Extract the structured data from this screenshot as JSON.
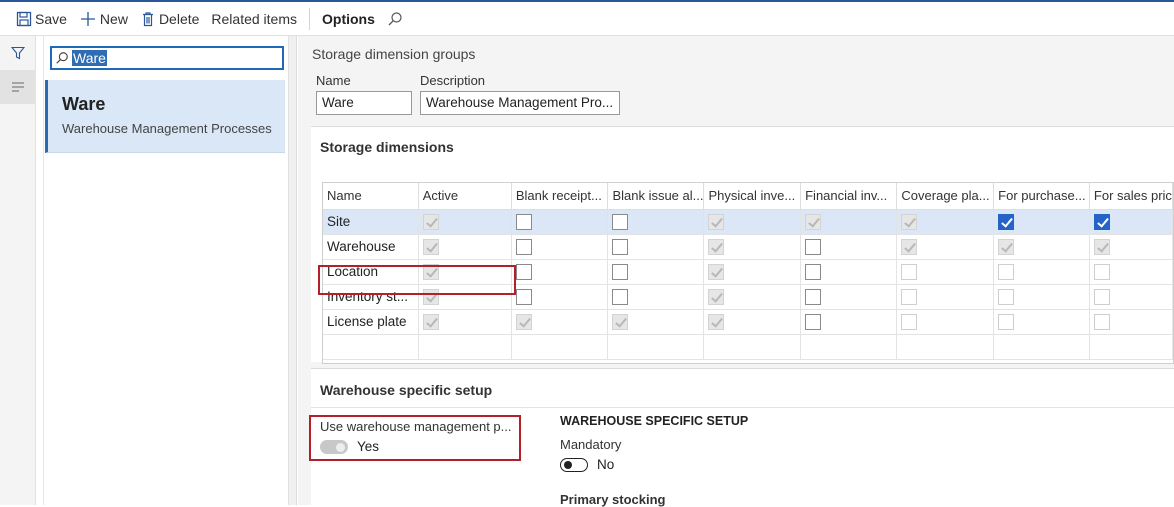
{
  "toolbar": {
    "save": "Save",
    "new": "New",
    "delete": "Delete",
    "related": "Related items",
    "options": "Options"
  },
  "search": {
    "value": "Ware"
  },
  "list": {
    "items": [
      {
        "title": "Ware",
        "subtitle": "Warehouse Management Processes"
      }
    ]
  },
  "header": {
    "breadcrumb": "Storage dimension groups",
    "name_label": "Name",
    "name_value": "Ware",
    "desc_label": "Description",
    "desc_value": "Warehouse Management Pro..."
  },
  "storage": {
    "title": "Storage dimensions",
    "columns": [
      "Name",
      "Active",
      "Blank receipt...",
      "Blank issue al...",
      "Physical inve...",
      "Financial inv...",
      "Coverage pla...",
      "For purchase...",
      "For sales pric"
    ],
    "rows": [
      {
        "name": "Site",
        "cells": [
          "dischk",
          "off",
          "off",
          "dischk",
          "dischk",
          "dischk",
          "chk",
          "chk"
        ]
      },
      {
        "name": "Warehouse",
        "cells": [
          "dischk",
          "off",
          "off",
          "dischk",
          "off",
          "dischk",
          "dischk",
          "dischk"
        ]
      },
      {
        "name": "Location",
        "cells": [
          "dischk",
          "off",
          "off",
          "dischk",
          "off",
          "dis",
          "dis",
          "dis"
        ]
      },
      {
        "name": "Inventory st...",
        "cells": [
          "dischk",
          "off",
          "off",
          "dischk",
          "off",
          "dis",
          "dis",
          "dis"
        ]
      },
      {
        "name": "License plate",
        "cells": [
          "dischk",
          "dischk",
          "dischk",
          "dischk",
          "off",
          "dis",
          "dis",
          "dis"
        ]
      }
    ],
    "selected_row": 0
  },
  "warehouse": {
    "title": "Warehouse specific setup",
    "use_wm_label": "Use warehouse management p...",
    "use_wm_value": "Yes",
    "group_title": "WAREHOUSE SPECIFIC SETUP",
    "mandatory_label": "Mandatory",
    "mandatory_value": "No",
    "primary_label": "Primary stocking"
  },
  "colors": {
    "accent": "#2463c7",
    "highlight": "#b3202a",
    "selection": "#dbe7f7"
  }
}
